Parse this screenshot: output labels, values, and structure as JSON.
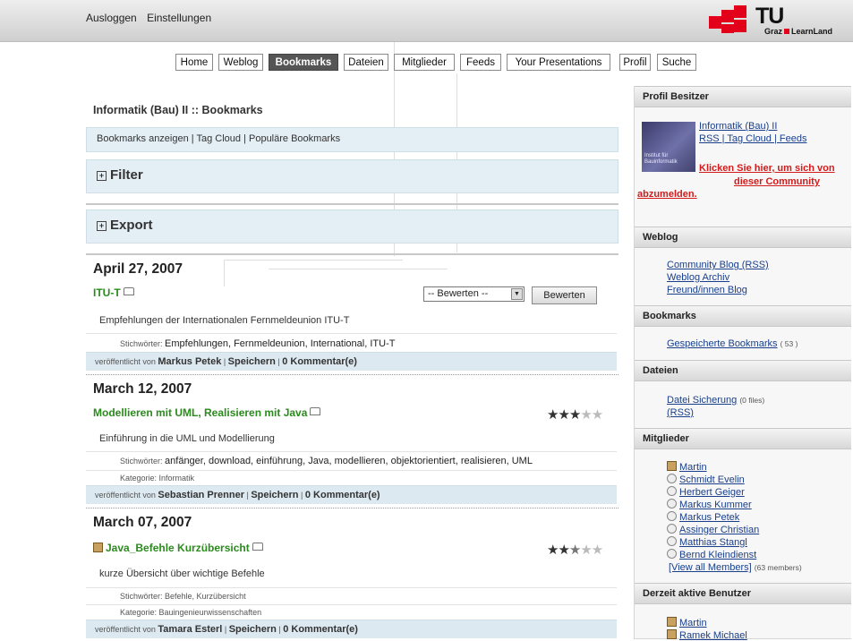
{
  "topbar": {
    "logout": "Ausloggen",
    "settings": "Einstellungen",
    "logo_text": "TU",
    "logo_sub_left": "Graz",
    "logo_sub_right": "LearnLand"
  },
  "nav": [
    "Home",
    "Weblog",
    "Bookmarks",
    "Dateien",
    "Mitglieder",
    "Feeds",
    "Your Presentations",
    "Profil",
    "Suche"
  ],
  "nav_active": "Bookmarks",
  "main": {
    "title": "Informatik (Bau) II :: Bookmarks",
    "subnav": "Bookmarks anzeigen | Tag Cloud | Populäre Bookmarks",
    "filter": "Filter",
    "export": "Export",
    "rate_select": "-- Bewerten --",
    "rate_button": "Bewerten",
    "entries": [
      {
        "date": "April 27, 2007",
        "title": "ITU-T",
        "rating": 0,
        "desc": "Empfehlungen der Internationalen Fernmeldeunion ITU-T",
        "tags_label": "Stichwörter:",
        "tags": "Empfehlungen, Fernmeldeunion, International, ITU-T",
        "category": "",
        "posted_by": "veröffentlicht von",
        "author": "Markus Petek",
        "save": "Speichern",
        "comments": "0 Kommentar(e)"
      },
      {
        "date": "March 12, 2007",
        "title": "Modellieren mit UML, Realisieren mit Java",
        "rating": 3,
        "desc": "Einführung in die UML und Modellierung",
        "tags_label": "Stichwörter:",
        "tags": "anfänger, download, einführung, Java, modellieren, objektorientiert, realisieren, UML",
        "category": "Kategorie: Informatik",
        "posted_by": "veröffentlicht von",
        "author": "Sebastian Prenner",
        "save": "Speichern",
        "comments": "0 Kommentar(e)"
      },
      {
        "date": "March 07, 2007",
        "title": "Java_Befehle Kurzübersicht",
        "rating": 2.5,
        "desc": "kurze Übersicht über wichtige Befehle",
        "tags_label": "Stichwörter:",
        "tags": "Befehle, Kurzübersicht",
        "category": "Kategorie: Bauingenieurwissenschaften",
        "posted_by": "veröffentlicht von",
        "author": "Tamara Esterl",
        "save": "Speichern",
        "comments": "0 Kommentar(e)"
      }
    ]
  },
  "sidebar": {
    "profile_header": "Profil Besitzer",
    "profile_name": "Informatik (Bau) II",
    "profile_links": "RSS | Tag Cloud | Feeds",
    "thumb_text": "Institut für Bauinformatik",
    "leave_line1": "Klicken Sie hier, um sich von",
    "leave_line2": "dieser Community",
    "leave_line3": "abzumelden.",
    "weblog_header": "Weblog",
    "weblog_links": [
      "Community Blog (RSS)",
      "Weblog Archiv",
      "Freund/innen Blog"
    ],
    "bookmarks_header": "Bookmarks",
    "bookmarks_saved": "Gespeicherte Bookmarks",
    "bookmarks_count": "( 53 )",
    "files_header": "Dateien",
    "files_link": "Datei Sicherung",
    "files_count": "(0 files)",
    "files_rss": "(RSS)",
    "members_header": "Mitglieder",
    "members": [
      "Martin",
      "Schmidt Evelin",
      "Herbert Geiger",
      "Markus Kummer",
      "Markus Petek",
      "Assinger Christian",
      "Matthias Stangl",
      "Bernd Kleindienst"
    ],
    "view_all": "[View all Members]",
    "members_count": "(63 members)",
    "active_header": "Derzeit aktive Benutzer",
    "active_users": [
      "Martin",
      "Ramek Michael"
    ]
  }
}
